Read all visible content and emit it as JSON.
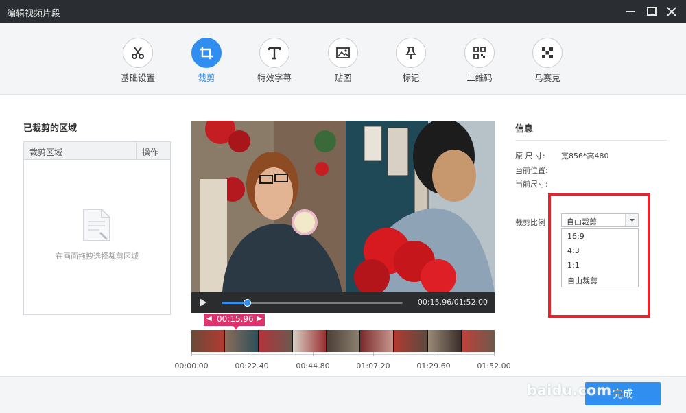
{
  "window": {
    "title": "编辑视频片段"
  },
  "toolbar": {
    "tabs": [
      {
        "label": "基础设置",
        "icon": "scissors-icon"
      },
      {
        "label": "裁剪",
        "icon": "crop-icon",
        "active": true
      },
      {
        "label": "特效字幕",
        "icon": "text-icon"
      },
      {
        "label": "贴图",
        "icon": "image-icon"
      },
      {
        "label": "标记",
        "icon": "pin-icon"
      },
      {
        "label": "二维码",
        "icon": "qrcode-icon"
      },
      {
        "label": "马赛克",
        "icon": "mosaic-icon"
      }
    ]
  },
  "crop_panel": {
    "title": "已裁剪的区域",
    "col_area": "裁剪区域",
    "col_action": "操作",
    "empty_hint": "在画面拖拽选择裁剪区域"
  },
  "player": {
    "time": "00:15.96/01:52.00",
    "progress": 0.142,
    "marker_time": "00:15.96",
    "ticks": [
      "00:00.00",
      "00:22.40",
      "00:44.80",
      "01:07.20",
      "01:29.60",
      "01:52.00"
    ]
  },
  "info": {
    "title": "信息",
    "orig_size_label": "原 尺 寸:",
    "orig_size_value": "宽856*高480",
    "cur_pos_label": "当前位置:",
    "cur_size_label": "当前尺寸:",
    "ratio_label": "裁剪比例",
    "ratio_selected": "自由裁剪",
    "ratio_options": [
      "16:9",
      "4:3",
      "1:1",
      "自由裁剪"
    ]
  },
  "footer": {
    "done_label": "完成",
    "watermark": "baidu.com"
  },
  "colors": {
    "accent": "#2f8ef0",
    "marker": "#e0336d",
    "highlight": "#e5242b",
    "titlebar": "#2a2d31"
  }
}
